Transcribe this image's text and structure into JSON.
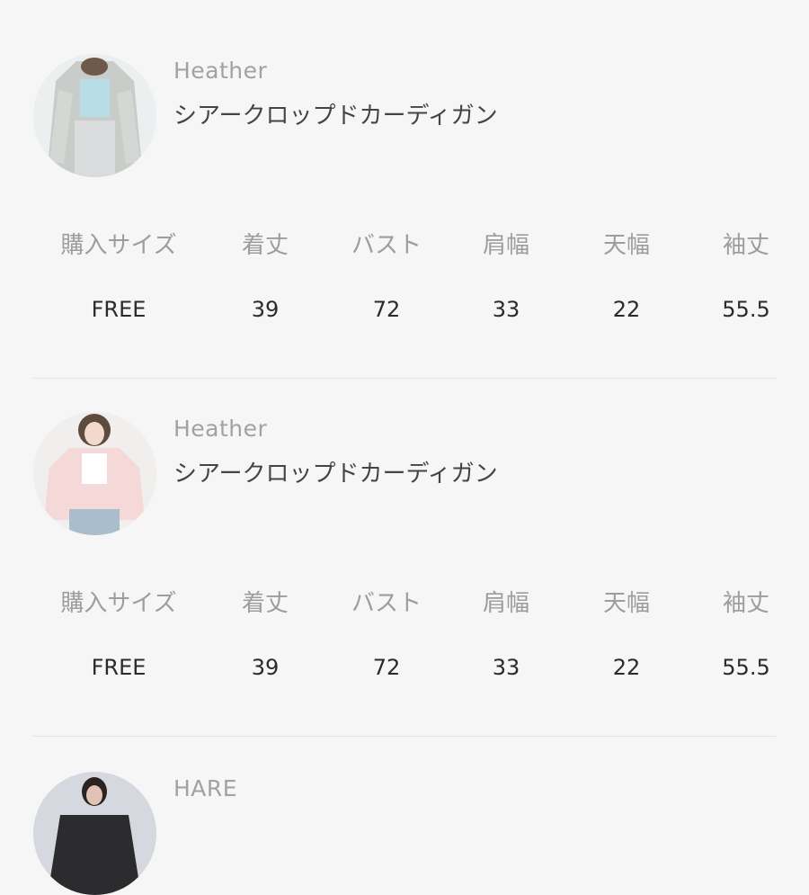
{
  "items": [
    {
      "brand": "Heather",
      "product_name": "シアークロップドカーディガン",
      "thumbnail": "cardigan-photo-1",
      "headers": [
        "購入サイズ",
        "着丈",
        "バスト",
        "肩幅",
        "天幅",
        "袖丈"
      ],
      "values": [
        "FREE",
        "39",
        "72",
        "33",
        "22",
        "55.5"
      ]
    },
    {
      "brand": "Heather",
      "product_name": "シアークロップドカーディガン",
      "thumbnail": "cardigan-photo-2",
      "headers": [
        "購入サイズ",
        "着丈",
        "バスト",
        "肩幅",
        "天幅",
        "袖丈"
      ],
      "values": [
        "FREE",
        "39",
        "72",
        "33",
        "22",
        "55.5"
      ]
    },
    {
      "brand": "HARE",
      "thumbnail": "jacket-photo-3"
    }
  ]
}
